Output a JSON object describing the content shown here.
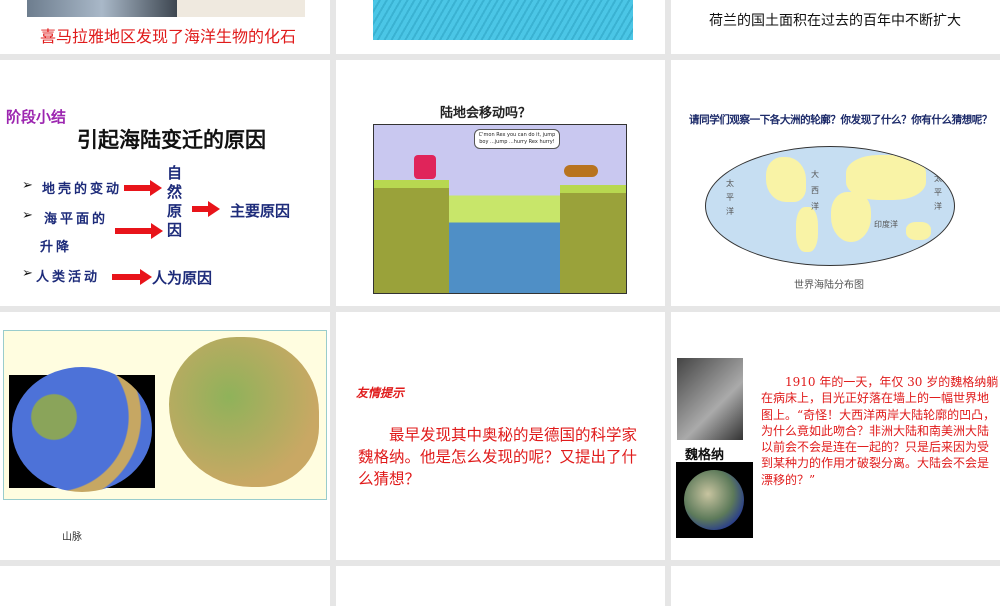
{
  "slides": [
    {
      "caption": "喜马拉雅地区发现了海洋生物的化石"
    },
    {},
    {
      "caption": "荷兰的国土面积在过去的百年中不断扩大"
    },
    {
      "tag": "阶段小结",
      "title": "引起海陆变迁的原因",
      "items": [
        "地壳的变动",
        "海平面的",
        "升降",
        "人类活动"
      ],
      "natural": [
        "自",
        "然",
        "原",
        "因"
      ],
      "main": "主要原因",
      "human": "人为原因"
    },
    {
      "title": "陆地会移动吗？",
      "bubble": "C'mon Rex you can do it, jump boy ...jump ...hurry Rex hurry!"
    },
    {
      "title": "请同学们观察一下各大洲的轮廓？你发现了什么？你有什么猜想呢？",
      "ocean_labels": [
        "太",
        "平",
        "洋",
        "大",
        "西",
        "洋",
        "印度洋",
        "太",
        "平",
        "洋"
      ],
      "caption": "世界海陆分布图"
    },
    {
      "caption": "山脉"
    },
    {
      "tag": "友情提示",
      "text": "最早发现其中奥秘的是德国的科学家魏格纳。他是怎么发现的呢？又提出了什么猜想？"
    },
    {
      "name": "魏格纳",
      "text": "1910 年的一天，年仅 30 岁的魏格纳躺在病床上，目光正好落在墙上的一幅世界地图上。“奇怪！大西洋两岸大陆轮廓的凹凸，为什么竟如此吻合？非洲大陆和南美洲大陆以前会不会是连在一起的？只是后来因为受到某种力的作用才破裂分离。大陆会不会是漂移的？”"
    }
  ]
}
